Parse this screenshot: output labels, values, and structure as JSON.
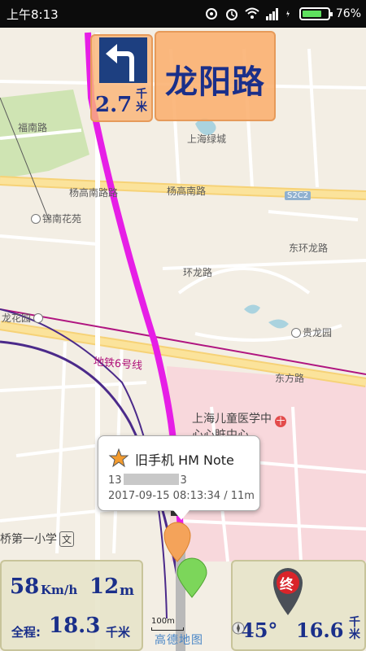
{
  "status_bar": {
    "time": "上午8:13",
    "battery": "76%",
    "battery_level": 0.76
  },
  "navigation": {
    "turn_direction": "left",
    "turn_distance": "2.7",
    "turn_distance_unit_top": "千",
    "turn_distance_unit_bottom": "米",
    "next_road": "龙阳路"
  },
  "map": {
    "labels": {
      "fuan_road": "福南路",
      "shanghai_lvcheng": "上海绿城",
      "yanggao_s_road_1": "杨高南路路",
      "yanggao_s_road_2": "杨高南路",
      "s2c2": "S2C2",
      "jinnan_huayuan": "锦南花苑",
      "donghuan_longlu": "东环龙路",
      "huanlong_road": "环龙路",
      "longhua_yuan": "龙花园",
      "guilong_yuan": "贵龙园",
      "metro_line6": "地铁6号线",
      "dongfang_road": "东方路",
      "childrens_hospital_line1": "上海儿童医学中",
      "childrens_hospital_line2": "心心脏中心",
      "hospital_badge": "十",
      "school": "桥第一小学",
      "school_badge": "文"
    }
  },
  "popup": {
    "device_name": "旧手机 HM Note",
    "phone_prefix": "13",
    "phone_suffix": "3",
    "timestamp_accuracy": "2017-09-15 08:13:34 / 11m"
  },
  "bottom_left": {
    "speed": "58",
    "speed_unit": "Km/h",
    "accuracy": "12",
    "accuracy_unit": "m",
    "total_label": "全程:",
    "total_distance": "18.3",
    "total_unit": "千米"
  },
  "bottom_right": {
    "end_marker": "终",
    "bearing": "45°",
    "remaining_distance": "16.6",
    "remaining_unit_top": "千",
    "remaining_unit_bottom": "米"
  },
  "scale": {
    "label": "100m"
  },
  "map_logo": "高德地图",
  "colors": {
    "route": "#e61ee6",
    "metro": "#b01580",
    "track": "#4b2a8a",
    "panel_text": "#1a2f8a"
  }
}
